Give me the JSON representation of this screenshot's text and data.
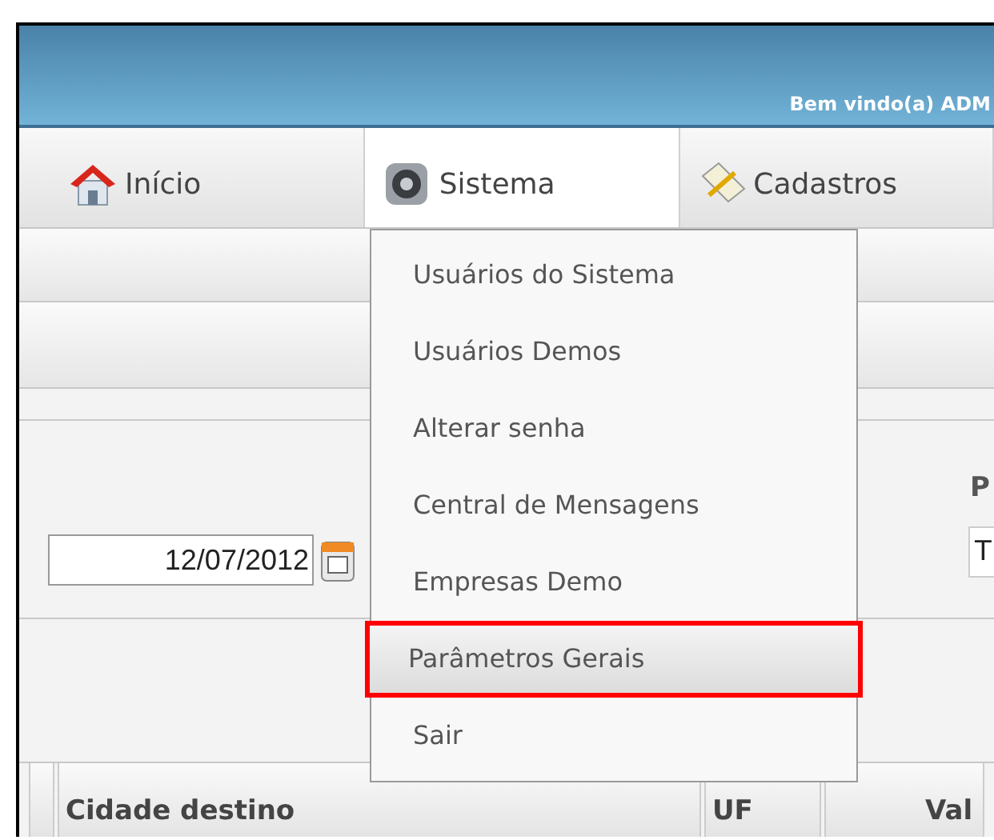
{
  "header": {
    "welcome": "Bem vindo(a) ADM"
  },
  "nav_tabs": [
    {
      "label": "Início",
      "selected": false
    },
    {
      "label": "Sistema",
      "selected": true
    },
    {
      "label": "Cadastros",
      "selected": false
    }
  ],
  "menu": {
    "items": [
      {
        "label": "Usuários do Sistema",
        "selected": false
      },
      {
        "label": "Usuários Demos",
        "selected": false
      },
      {
        "label": "Alterar senha",
        "selected": false
      },
      {
        "label": "Central de Mensagens",
        "selected": false
      },
      {
        "label": "Empresas Demo",
        "selected": false
      },
      {
        "label": "Parâmetros Gerais",
        "selected": true
      },
      {
        "label": "Sair",
        "selected": false
      }
    ]
  },
  "form": {
    "date_value": "12/07/2012",
    "right_label": "P",
    "right_field_value": "T"
  },
  "table": {
    "columns": [
      "Cidade destino",
      "UF",
      "Val"
    ]
  }
}
